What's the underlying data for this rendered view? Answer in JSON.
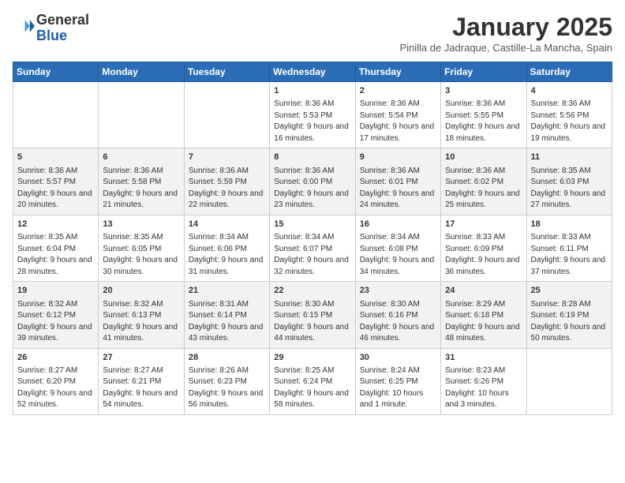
{
  "header": {
    "logo_line1": "General",
    "logo_line2": "Blue",
    "month_title": "January 2025",
    "subtitle": "Pinilla de Jadraque, Castille-La Mancha, Spain"
  },
  "weekdays": [
    "Sunday",
    "Monday",
    "Tuesday",
    "Wednesday",
    "Thursday",
    "Friday",
    "Saturday"
  ],
  "weeks": [
    [
      {
        "day": "",
        "sunrise": "",
        "sunset": "",
        "daylight": ""
      },
      {
        "day": "",
        "sunrise": "",
        "sunset": "",
        "daylight": ""
      },
      {
        "day": "",
        "sunrise": "",
        "sunset": "",
        "daylight": ""
      },
      {
        "day": "1",
        "sunrise": "Sunrise: 8:36 AM",
        "sunset": "Sunset: 5:53 PM",
        "daylight": "Daylight: 9 hours and 16 minutes."
      },
      {
        "day": "2",
        "sunrise": "Sunrise: 8:36 AM",
        "sunset": "Sunset: 5:54 PM",
        "daylight": "Daylight: 9 hours and 17 minutes."
      },
      {
        "day": "3",
        "sunrise": "Sunrise: 8:36 AM",
        "sunset": "Sunset: 5:55 PM",
        "daylight": "Daylight: 9 hours and 18 minutes."
      },
      {
        "day": "4",
        "sunrise": "Sunrise: 8:36 AM",
        "sunset": "Sunset: 5:56 PM",
        "daylight": "Daylight: 9 hours and 19 minutes."
      }
    ],
    [
      {
        "day": "5",
        "sunrise": "Sunrise: 8:36 AM",
        "sunset": "Sunset: 5:57 PM",
        "daylight": "Daylight: 9 hours and 20 minutes."
      },
      {
        "day": "6",
        "sunrise": "Sunrise: 8:36 AM",
        "sunset": "Sunset: 5:58 PM",
        "daylight": "Daylight: 9 hours and 21 minutes."
      },
      {
        "day": "7",
        "sunrise": "Sunrise: 8:36 AM",
        "sunset": "Sunset: 5:59 PM",
        "daylight": "Daylight: 9 hours and 22 minutes."
      },
      {
        "day": "8",
        "sunrise": "Sunrise: 8:36 AM",
        "sunset": "Sunset: 6:00 PM",
        "daylight": "Daylight: 9 hours and 23 minutes."
      },
      {
        "day": "9",
        "sunrise": "Sunrise: 8:36 AM",
        "sunset": "Sunset: 6:01 PM",
        "daylight": "Daylight: 9 hours and 24 minutes."
      },
      {
        "day": "10",
        "sunrise": "Sunrise: 8:36 AM",
        "sunset": "Sunset: 6:02 PM",
        "daylight": "Daylight: 9 hours and 25 minutes."
      },
      {
        "day": "11",
        "sunrise": "Sunrise: 8:35 AM",
        "sunset": "Sunset: 6:03 PM",
        "daylight": "Daylight: 9 hours and 27 minutes."
      }
    ],
    [
      {
        "day": "12",
        "sunrise": "Sunrise: 8:35 AM",
        "sunset": "Sunset: 6:04 PM",
        "daylight": "Daylight: 9 hours and 28 minutes."
      },
      {
        "day": "13",
        "sunrise": "Sunrise: 8:35 AM",
        "sunset": "Sunset: 6:05 PM",
        "daylight": "Daylight: 9 hours and 30 minutes."
      },
      {
        "day": "14",
        "sunrise": "Sunrise: 8:34 AM",
        "sunset": "Sunset: 6:06 PM",
        "daylight": "Daylight: 9 hours and 31 minutes."
      },
      {
        "day": "15",
        "sunrise": "Sunrise: 8:34 AM",
        "sunset": "Sunset: 6:07 PM",
        "daylight": "Daylight: 9 hours and 32 minutes."
      },
      {
        "day": "16",
        "sunrise": "Sunrise: 8:34 AM",
        "sunset": "Sunset: 6:08 PM",
        "daylight": "Daylight: 9 hours and 34 minutes."
      },
      {
        "day": "17",
        "sunrise": "Sunrise: 8:33 AM",
        "sunset": "Sunset: 6:09 PM",
        "daylight": "Daylight: 9 hours and 36 minutes."
      },
      {
        "day": "18",
        "sunrise": "Sunrise: 8:33 AM",
        "sunset": "Sunset: 6:11 PM",
        "daylight": "Daylight: 9 hours and 37 minutes."
      }
    ],
    [
      {
        "day": "19",
        "sunrise": "Sunrise: 8:32 AM",
        "sunset": "Sunset: 6:12 PM",
        "daylight": "Daylight: 9 hours and 39 minutes."
      },
      {
        "day": "20",
        "sunrise": "Sunrise: 8:32 AM",
        "sunset": "Sunset: 6:13 PM",
        "daylight": "Daylight: 9 hours and 41 minutes."
      },
      {
        "day": "21",
        "sunrise": "Sunrise: 8:31 AM",
        "sunset": "Sunset: 6:14 PM",
        "daylight": "Daylight: 9 hours and 43 minutes."
      },
      {
        "day": "22",
        "sunrise": "Sunrise: 8:30 AM",
        "sunset": "Sunset: 6:15 PM",
        "daylight": "Daylight: 9 hours and 44 minutes."
      },
      {
        "day": "23",
        "sunrise": "Sunrise: 8:30 AM",
        "sunset": "Sunset: 6:16 PM",
        "daylight": "Daylight: 9 hours and 46 minutes."
      },
      {
        "day": "24",
        "sunrise": "Sunrise: 8:29 AM",
        "sunset": "Sunset: 6:18 PM",
        "daylight": "Daylight: 9 hours and 48 minutes."
      },
      {
        "day": "25",
        "sunrise": "Sunrise: 8:28 AM",
        "sunset": "Sunset: 6:19 PM",
        "daylight": "Daylight: 9 hours and 50 minutes."
      }
    ],
    [
      {
        "day": "26",
        "sunrise": "Sunrise: 8:27 AM",
        "sunset": "Sunset: 6:20 PM",
        "daylight": "Daylight: 9 hours and 52 minutes."
      },
      {
        "day": "27",
        "sunrise": "Sunrise: 8:27 AM",
        "sunset": "Sunset: 6:21 PM",
        "daylight": "Daylight: 9 hours and 54 minutes."
      },
      {
        "day": "28",
        "sunrise": "Sunrise: 8:26 AM",
        "sunset": "Sunset: 6:23 PM",
        "daylight": "Daylight: 9 hours and 56 minutes."
      },
      {
        "day": "29",
        "sunrise": "Sunrise: 8:25 AM",
        "sunset": "Sunset: 6:24 PM",
        "daylight": "Daylight: 9 hours and 58 minutes."
      },
      {
        "day": "30",
        "sunrise": "Sunrise: 8:24 AM",
        "sunset": "Sunset: 6:25 PM",
        "daylight": "Daylight: 10 hours and 1 minute."
      },
      {
        "day": "31",
        "sunrise": "Sunrise: 8:23 AM",
        "sunset": "Sunset: 6:26 PM",
        "daylight": "Daylight: 10 hours and 3 minutes."
      },
      {
        "day": "",
        "sunrise": "",
        "sunset": "",
        "daylight": ""
      }
    ]
  ]
}
